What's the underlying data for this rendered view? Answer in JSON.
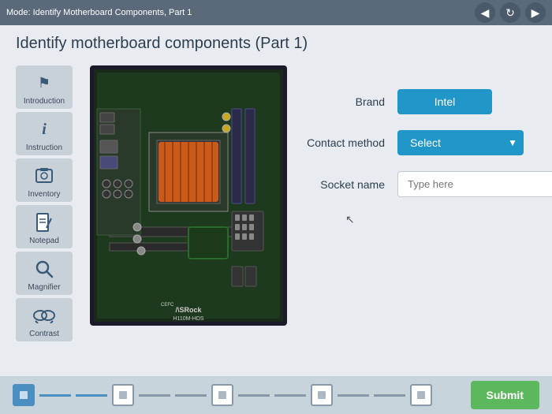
{
  "topbar": {
    "title": "Mode: Identify Motherboard Components, Part 1"
  },
  "nav": {
    "back_label": "◀",
    "refresh_label": "↻",
    "forward_label": "▶"
  },
  "page": {
    "title": "Identify motherboard components (Part 1)"
  },
  "sidebar": {
    "items": [
      {
        "id": "introduction",
        "label": "Introduction",
        "icon": "⚑"
      },
      {
        "id": "instruction",
        "label": "Instruction",
        "icon": "ℹ"
      },
      {
        "id": "inventory",
        "label": "Inventory",
        "icon": "🖥"
      },
      {
        "id": "notepad",
        "label": "Notepad",
        "icon": "✏"
      },
      {
        "id": "magnifier",
        "label": "Magnifier",
        "icon": "🔍"
      },
      {
        "id": "contrast",
        "label": "Contrast",
        "icon": "👓"
      }
    ]
  },
  "form": {
    "brand_label": "Brand",
    "brand_value": "Intel",
    "contact_method_label": "Contact method",
    "contact_method_value": "Select",
    "socket_name_label": "Socket name",
    "socket_name_placeholder": "Type here"
  },
  "bottom": {
    "submit_label": "Submit"
  },
  "colors": {
    "accent": "#2196c8",
    "submit": "#5cb85c"
  }
}
